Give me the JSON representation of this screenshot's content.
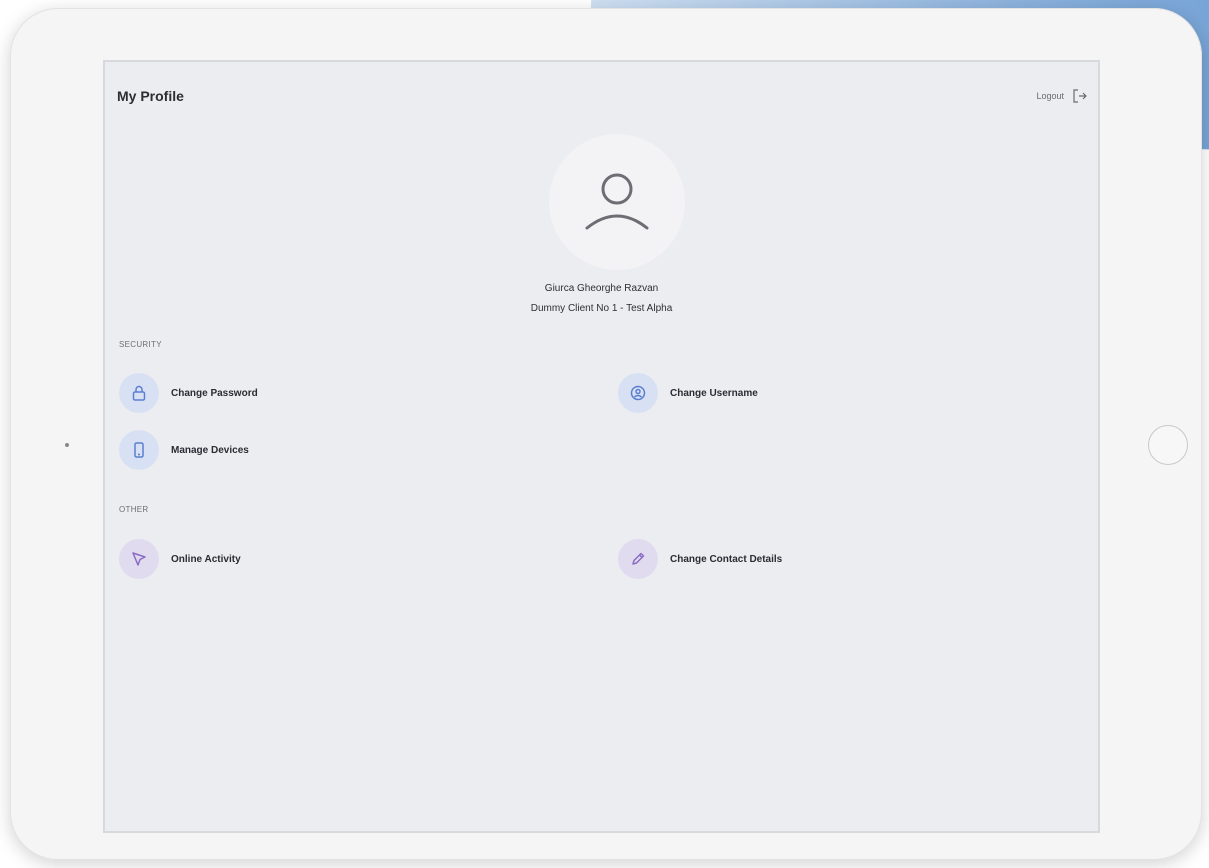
{
  "header": {
    "title": "My Profile",
    "logout_label": "Logout"
  },
  "profile": {
    "name": "Giurca Gheorghe Razvan",
    "client": "Dummy Client No 1 - Test Alpha"
  },
  "sections": {
    "security": {
      "label": "SECURITY",
      "items": [
        {
          "label": "Change Password",
          "icon": "lock-icon"
        },
        {
          "label": "Change Username",
          "icon": "user-circle-icon"
        },
        {
          "label": "Manage Devices",
          "icon": "phone-icon"
        }
      ]
    },
    "other": {
      "label": "OTHER",
      "items": [
        {
          "label": "Online Activity",
          "icon": "cursor-icon"
        },
        {
          "label": "Change Contact Details",
          "icon": "pencil-icon"
        }
      ]
    }
  },
  "colors": {
    "screen_bg": "#ecedf1",
    "icon_blue": "#5b7fd0",
    "icon_blue_bg": "#d8e1f4",
    "icon_purple": "#8a6cc4",
    "icon_purple_bg": "#e1dbef"
  }
}
